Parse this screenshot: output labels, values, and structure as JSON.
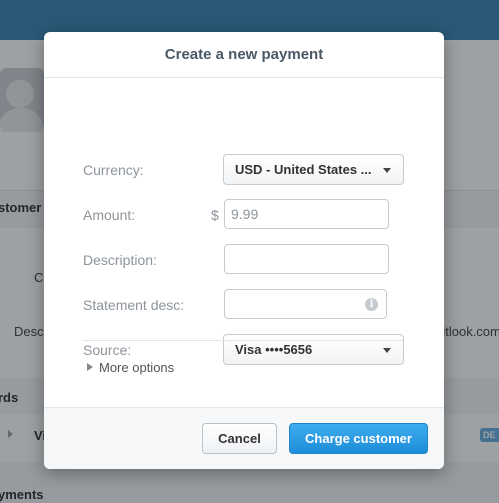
{
  "background": {
    "texts": {
      "customer": "stomer",
      "c_label": "C",
      "desc_label": "Desc",
      "email_tail": "utlook.com",
      "cards": "rds",
      "visa_snip": "Vi",
      "badge": "DE",
      "payments": "yments"
    }
  },
  "modal": {
    "title": "Create a new payment",
    "fields": {
      "currency": {
        "label": "Currency:",
        "value": "USD - United States ..."
      },
      "amount": {
        "label": "Amount:",
        "symbol": "$",
        "placeholder": "9.99"
      },
      "description": {
        "label": "Description:",
        "value": ""
      },
      "statement": {
        "label": "Statement desc:",
        "value": "",
        "info_icon": "i"
      },
      "source": {
        "label": "Source:",
        "value": "Visa ••••5656"
      }
    },
    "more_options": "More options",
    "buttons": {
      "cancel": "Cancel",
      "charge": "Charge customer"
    }
  },
  "colors": {
    "accent": "#1d8dd8",
    "topbar": "#2a7cb0"
  }
}
